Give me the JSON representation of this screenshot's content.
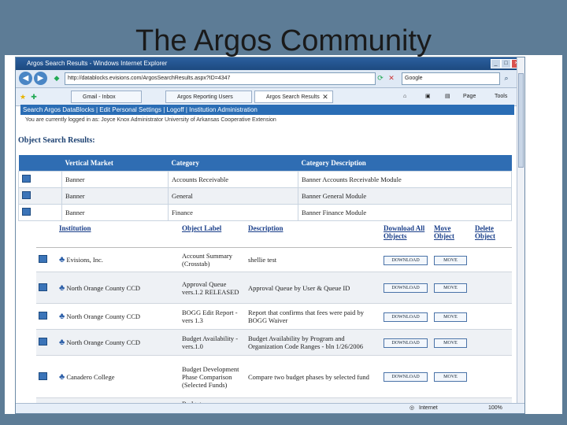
{
  "slide": {
    "title": "The Argos Community",
    "frame_color": "#5d7c96"
  },
  "browser": {
    "window_title": "Argos Search Results - Windows Internet Explorer",
    "url": "http://datablocks.evisions.com/ArgosSearchResults.aspx?ID=4347",
    "search_placeholder": "Google",
    "tabs": [
      "Gmail - Inbox",
      "Argos Reporting Users",
      "Argos Search Results"
    ],
    "tools": [
      "Page",
      "Tools"
    ],
    "status_zone": "Internet",
    "zoom": "100%"
  },
  "nav_links": [
    "Search Argos DataBlocks",
    "Edit Personal Settings",
    "Logoff",
    "Institution Administration"
  ],
  "user_line": "You are currently logged in as:   Joyce Knox   Administrator   University of Arkansas Cooperative Extension",
  "results_heading": "Object Search Results:",
  "category_table": {
    "headers": [
      "Vertical Market",
      "Category",
      "Category Description"
    ],
    "rows": [
      [
        "Banner",
        "Accounts Receivable",
        "Banner Accounts Receivable Module"
      ],
      [
        "Banner",
        "General",
        "Banner General Module"
      ],
      [
        "Banner",
        "Finance",
        "Banner Finance Module"
      ]
    ]
  },
  "object_table": {
    "headers": [
      "Institution",
      "Object Label",
      "Description",
      "Download All Objects",
      "Move Object",
      "Delete Object"
    ],
    "download_label": "DOWNLOAD",
    "move_label": "MOVE",
    "rows": [
      {
        "institution": "Evisions, Inc.",
        "label": "Account Summary (Crosstab)",
        "description": "shellie test"
      },
      {
        "institution": "North Orange County CCD",
        "label": "Approval Queue vers.1.2 RELEASED",
        "description": "Approval Queue by User & Queue ID"
      },
      {
        "institution": "North Orange County CCD",
        "label": "BOGG Edit Report - vers 1.3",
        "description": "Report that confirms that fees were paid by BOGG Waiver"
      },
      {
        "institution": "North Orange County CCD",
        "label": "Budget Availability - vers.1.0",
        "description": "Budget Availability by Program and Organization Code Ranges - bln 1/26/2006"
      },
      {
        "institution": "Canadero College",
        "label": "Budget Development Phase Comparison (Selected Funds)",
        "description": "Compare two budget phases by selected fund"
      },
      {
        "institution": "",
        "label": "Budget",
        "description": ""
      }
    ]
  }
}
